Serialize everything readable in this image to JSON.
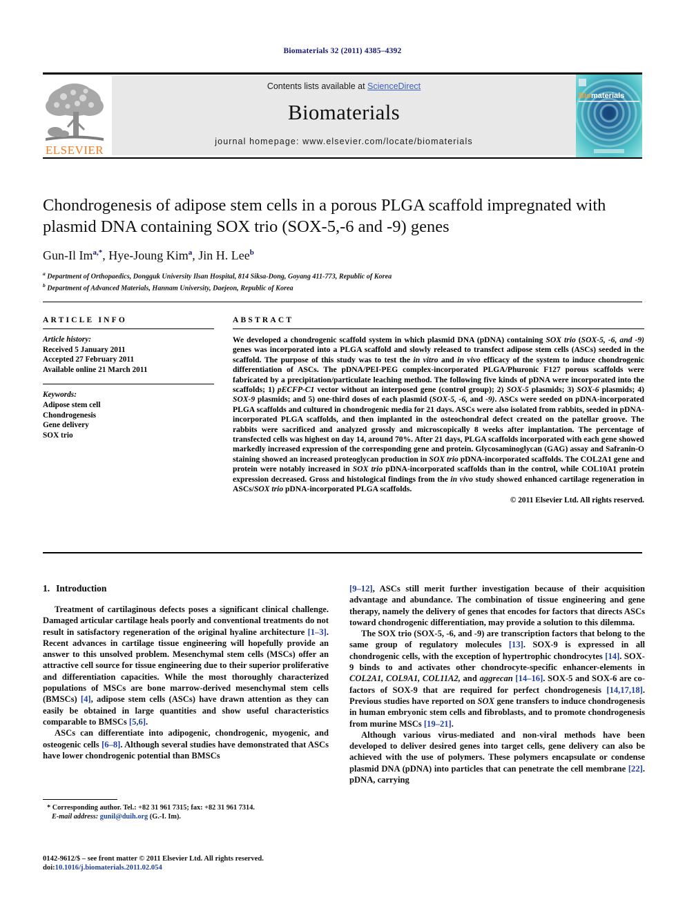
{
  "running_head": "Biomaterials 32 (2011) 4385–4392",
  "masthead": {
    "contents_prefix": "Contents lists available at ",
    "contents_link": "ScienceDirect",
    "journal_name": "Biomaterials",
    "homepage": "journal homepage: www.elsevier.com/locate/biomaterials",
    "publisher_logo_text": "ELSEVIER",
    "cover_title_prefix": "Bio",
    "cover_title_suffix": "materials",
    "link_color": "#3b5fc0",
    "logo_color": "#f47b20",
    "cover_color": "#2ea3b5"
  },
  "article": {
    "title": "Chondrogenesis of adipose stem cells in a porous PLGA scaffold impregnated with plasmid DNA containing SOX trio (SOX-5,-6 and -9) genes",
    "authors_html": "Gun-Il Im<sup>a,*</sup>, Hye-Joung Kim<sup>a</sup>, Jin H. Lee<sup>b</sup>",
    "affiliations": [
      "Department of Orthopaedics, Dongguk University Ilsan Hospital, 814 Siksa-Dong, Goyang 411-773, Republic of Korea",
      "Department of Advanced Materials, Hannam University, Daejeon, Republic of Korea"
    ]
  },
  "article_info": {
    "heading": "ARTICLE INFO",
    "history_label": "Article history:",
    "history": [
      "Received 5 January 2011",
      "Accepted 27 February 2011",
      "Available online 21 March 2011"
    ],
    "keywords_label": "Keywords:",
    "keywords": [
      "Adipose stem cell",
      "Chondrogenesis",
      "Gene delivery",
      "SOX trio"
    ]
  },
  "abstract": {
    "heading": "ABSTRACT",
    "text_html": "We developed a chondrogenic scaffold system in which plasmid DNA (pDNA) containing <i>SOX trio</i> (<i>SOX-5, -6, and -9)</i> genes was incorporated into a PLGA scaffold and slowly released to transfect adipose stem cells (ASCs) seeded in the scaffold. The purpose of this study was to test the <i>in vitro</i> and <i>in vivo</i> efficacy of the system to induce chondrogenic differentiation of ASCs. The pDNA/PEI-PEG complex-incorporated PLGA/Phuronic F127 porous scaffolds were fabricated by a precipitation/particulate leaching method. The following five kinds of pDNA were incorporated into the scaffolds; 1) <i>pECFP-C1</i> vector without an interposed gene (control group); 2) <i>SOX-5</i> plasmids; 3) <i>SOX-6</i> plasmids; 4) <i>SOX-9</i> plasmids; and 5) one-third doses of each plasmid (<i>SOX-5, -6,</i> and <i>-9)</i>. ASCs were seeded on pDNA-incorporated PLGA scaffolds and cultured in chondrogenic media for 21 days. ASCs were also isolated from rabbits, seeded in pDNA-incorporated PLGA scaffolds, and then implanted in the osteochondral defect created on the patellar groove. The rabbits were sacrificed and analyzed grossly and microscopically 8 weeks after implantation. The percentage of transfected cells was highest on day 14, around 70%. After 21 days, PLGA scaffolds incorporated with each gene showed markedly increased expression of the corresponding gene and protein. Glycosaminoglycan (GAG) assay and Safranin-O staining showed an increased proteoglycan production in <i>SOX trio</i> pDNA-incorporated scaffolds. The COL2A1 gene and protein were notably increased in <i>SOX trio</i> pDNA-incorporated scaffolds than in the control, while COL10A1 protein expression decreased. Gross and histological findings from the <i>in vivo</i> study showed enhanced cartilage regeneration in ASCs/<i>SOX trio</i> pDNA-incorporated PLGA scaffolds.",
    "copyright": "© 2011 Elsevier Ltd. All rights reserved."
  },
  "body": {
    "section_number": "1.",
    "section_title": "Introduction",
    "left_paragraphs_html": [
      "Treatment of cartilaginous defects poses a significant clinical challenge. Damaged articular cartilage heals poorly and conventional treatments do not result in satisfactory regeneration of the original hyaline architecture <span class=\"ref\">[1–3]</span>. Recent advances in cartilage tissue engineering will hopefully provide an answer to this unsolved problem. Mesenchymal stem cells (MSCs) offer an attractive cell source for tissue engineering due to their superior proliferative and differentiation capacities. While the most thoroughly characterized populations of MSCs are bone marrow-derived mesenchymal stem cells (BMSCs) <span class=\"ref\">[4]</span>, adipose stem cells (ASCs) have drawn attention as they can easily be obtained in large quantities and show useful characteristics comparable to BMSCs <span class=\"ref\">[5,6]</span>.",
      "ASCs can differentiate into adipogenic, chondrogenic, myogenic, and osteogenic cells <span class=\"ref\">[6–8]</span>. Although several studies have demonstrated that ASCs have lower chondrogenic potential than BMSCs"
    ],
    "right_paragraphs_html": [
      "<span class=\"ref\">[9–12]</span>, ASCs still merit further investigation because of their acquisition advantage and abundance. The combination of tissue engineering and gene therapy, namely the delivery of genes that encodes for factors that directs ASCs toward chondrogenic differentiation, may provide a solution to this dilemma.",
      "The SOX trio (SOX-5, -6, and -9) are transcription factors that belong to the same group of regulatory molecules <span class=\"ref\">[13]</span>. SOX-9 is expressed in all chondrogenic cells, with the exception of hypertrophic chondrocytes <span class=\"ref\">[14]</span>. SOX-9 binds to and activates other chondrocyte-specific enhancer-elements in <span class=\"it\">COL2A1, COL9A1, COL11A2,</span> and <span class=\"it\">aggrecan</span> <span class=\"ref\">[14–16]</span>. SOX-5 and SOX-6 are co-factors of SOX-9 that are required for perfect chondrogenesis <span class=\"ref\">[14,17,18]</span>. Previous studies have reported on <span class=\"it\">SOX</span> gene transfers to induce chondrogenesis in human embryonic stem cells and fibroblasts, and to promote chondrogenesis from murine MSCs <span class=\"ref\">[19–21]</span>.",
      "Although various virus-mediated and non-viral methods have been developed to deliver desired genes into target cells, gene delivery can also be achieved with the use of polymers. These polymers encapsulate or condense plasmid DNA (pDNA) into particles that can penetrate the cell membrane <span class=\"ref\">[22]</span>. pDNA, carrying"
    ]
  },
  "footnote": {
    "corresponding_html": "* Corresponding author. Tel.: +82 31 961 7315; fax: +82 31 961 7314.",
    "email_html": "<i>E-mail address:</i> <span class=\"lnk\">gunil@duih.org</span> (G.-I. Im)."
  },
  "issn": {
    "line1_html": "0142-9612/$ – see front matter © 2011 Elsevier Ltd. All rights reserved.",
    "line2_prefix": "doi:",
    "line2_link": "10.1016/j.biomaterials.2011.02.054"
  }
}
